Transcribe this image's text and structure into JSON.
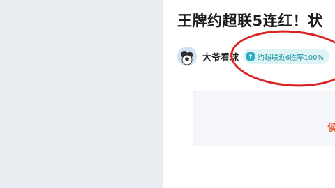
{
  "article": {
    "title": "王牌约超联5连红！状",
    "author": {
      "name": "大爷看球",
      "avatar_icon": "football-avatar-icon"
    },
    "tag": {
      "icon": "up-arrow-icon",
      "text": "约超联近6胜率100%"
    }
  },
  "card": {
    "visible_char": "侯"
  },
  "colors": {
    "left_pane": "#e9ecf0",
    "title": "#1c1c1c",
    "tag_background": "#dff5f5",
    "tag_text": "#1c8ea0",
    "card_accent": "#e2572c",
    "annotation": "#d92222"
  }
}
